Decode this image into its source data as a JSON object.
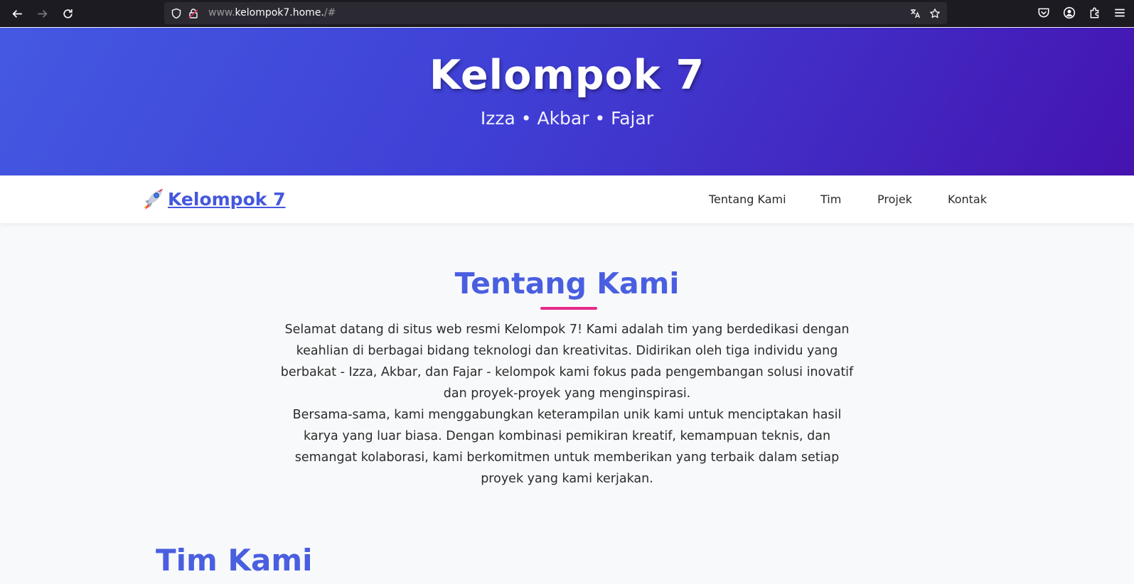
{
  "browser": {
    "url_prefix": "www.",
    "url_domain": "kelompok7.home.",
    "url_suffix": "/#",
    "icons": [
      "back-arrow-icon",
      "forward-arrow-icon",
      "reload-icon",
      "shield-icon",
      "lock-icon",
      "translate-icon",
      "bookmark-star-icon",
      "pocket-icon",
      "account-icon",
      "extensions-icon",
      "menu-icon"
    ]
  },
  "hero": {
    "title": "Kelompok 7",
    "subtitle": "Izza • Akbar • Fajar"
  },
  "navbar": {
    "brand_label": "Kelompok 7",
    "links": [
      "Tentang Kami",
      "Tim",
      "Projek",
      "Kontak"
    ]
  },
  "about": {
    "title": "Tentang Kami",
    "paragraph1": "Selamat datang di situs web resmi Kelompok 7! Kami adalah tim yang berdedikasi dengan keahlian di berbagai bidang teknologi dan kreativitas. Didirikan oleh tiga individu yang berbakat - Izza, Akbar, dan Fajar - kelompok kami fokus pada pengembangan solusi inovatif dan proyek-proyek yang menginspirasi.",
    "paragraph2": "Bersama-sama, kami menggabungkan keterampilan unik kami untuk menciptakan hasil karya yang luar biasa. Dengan kombinasi pemikiran kreatif, kemampuan teknis, dan semangat kolaborasi, kami berkomitmen untuk memberikan yang terbaik dalam setiap proyek yang kami kerjakan."
  },
  "team": {
    "title": "Tim Kami"
  },
  "colors": {
    "accent": "#4a5fe0",
    "underline": "#e6298a",
    "hero_start": "#4459e2",
    "hero_end": "#4513b0"
  }
}
